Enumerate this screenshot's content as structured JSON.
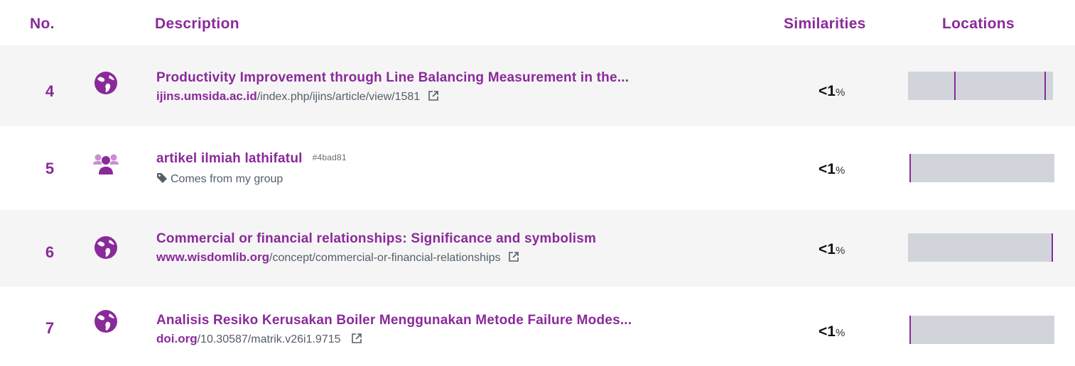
{
  "colors": {
    "accent": "#8a2a9a",
    "bar_bg": "#d1d5db",
    "band_bg": "#f5f5f5"
  },
  "header": {
    "no": "No.",
    "description": "Description",
    "similarities": "Similarities",
    "locations": "Locations"
  },
  "rows": [
    {
      "no": "4",
      "icon": "globe-icon",
      "title": "Productivity Improvement through Line Balancing Measurement in the...",
      "domain": "ijins.umsida.ac.id",
      "path": "/index.php/ijins/article/view/1581",
      "similarity": "<1",
      "pct": "%",
      "location_fractions": [
        0.32,
        0.94
      ]
    },
    {
      "no": "5",
      "icon": "users-group-icon",
      "title": "artikel ilmiah lathifatul",
      "tag_id": "#4bad81",
      "tag_text": "Comes from my group",
      "similarity": "<1",
      "pct": "%",
      "location_fractions": [
        0.0
      ]
    },
    {
      "no": "6",
      "icon": "globe-icon",
      "title": "Commercial or financial relationships: Significance and symbolism",
      "domain": "www.wisdomlib.org",
      "path": "/concept/commercial-or-financial-relationships",
      "similarity": "<1",
      "pct": "%",
      "location_fractions": [
        0.99
      ]
    },
    {
      "no": "7",
      "icon": "globe-icon",
      "title": "Analisis Resiko Kerusakan Boiler Menggunakan Metode Failure Modes...",
      "domain": "doi.org",
      "path": "/10.30587/matrik.v26i1.9715",
      "similarity": "<1",
      "pct": "%",
      "location_fractions": [
        0.0
      ]
    }
  ]
}
